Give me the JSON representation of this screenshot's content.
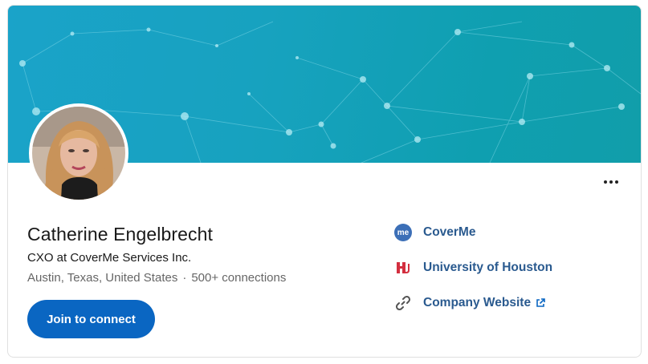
{
  "profile": {
    "name": "Catherine Engelbrecht",
    "headline": "CXO at CoverMe Services Inc.",
    "location": "Austin, Texas, United States",
    "separator": "·",
    "connections": "500+ connections"
  },
  "actions": {
    "join_label": "Join to connect",
    "more_icon": "more-options-icon"
  },
  "side_links": [
    {
      "label": "CoverMe",
      "icon": "coverme-logo-icon",
      "icon_text": "me"
    },
    {
      "label": "University of Houston",
      "icon": "university-of-houston-logo-icon"
    },
    {
      "label": "Company Website",
      "icon": "link-icon"
    }
  ],
  "colors": {
    "accent": "#0a66c2",
    "link": "#2a5a8f",
    "banner": "#17a2bf"
  }
}
